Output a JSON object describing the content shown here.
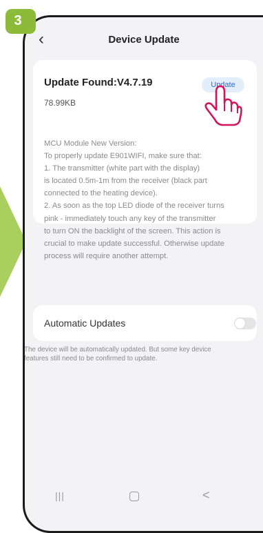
{
  "step_badge": "3",
  "header": {
    "title": "Device Update"
  },
  "update_card": {
    "found_label": "Update Found:V4.7.19",
    "size": "78.99KB",
    "update_button": "Update",
    "description": [
      "MCU Module New Version:",
      "To properly update E901WIFI, make sure that:",
      "1. The transmitter (white part with the display)",
      "is located 0.5m-1m from the receiver (black part",
      "connected to the heating device).",
      "2. As soon as the top LED diode of the receiver turns",
      "pink - immediately touch any key of the transmitter",
      "to turn ON the backlight of the screen. This action is",
      "crucial to make update successful. Otherwise update",
      "process will require another attempt."
    ]
  },
  "auto_update": {
    "label": "Automatic Updates",
    "enabled": false,
    "note": [
      "The device will be automatically updated. But some key device",
      "features still need to be confirmed to update."
    ]
  },
  "nav": {
    "recent": "|||",
    "back": "<"
  },
  "icons": {
    "back": "chevron-left-icon",
    "pointer": "hand-pointer-icon",
    "home": "home-square-icon"
  },
  "colors": {
    "accent": "#2d6bd0",
    "badge": "#8cbb3a",
    "arrow": "#a9cf5e",
    "hand": "#d4145a"
  }
}
